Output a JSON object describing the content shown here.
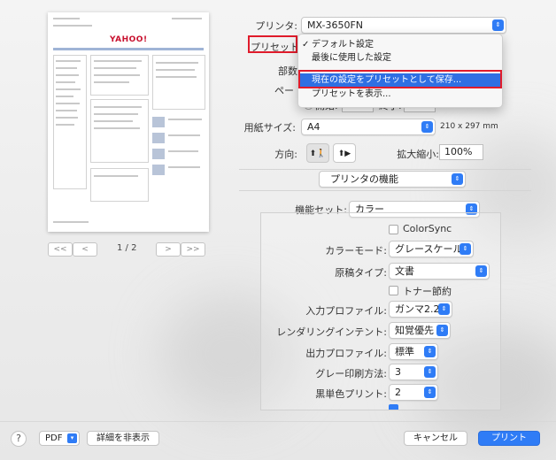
{
  "printer": {
    "label": "プリンタ:",
    "value": "MX-3650FN"
  },
  "preset": {
    "label": "プリセット",
    "menu": {
      "items": [
        {
          "text": "デフォルト設定",
          "checked": true
        },
        {
          "text": "最後に使用した設定"
        },
        {
          "text": "現在の設定をプリセットとして保存...",
          "highlighted": true
        },
        {
          "text": "プリセットを表示..."
        }
      ]
    }
  },
  "partial_labels": {
    "copies": "部数",
    "pages": "ペー"
  },
  "range": {
    "from_label": "開始:",
    "from_value": "1",
    "to_label": "終了:",
    "to_value": "1"
  },
  "paper": {
    "label": "用紙サイズ:",
    "value": "A4",
    "dims": "210 x 297 mm"
  },
  "orientation": {
    "label": "方向:",
    "portrait_glyph": "⬆🚶",
    "landscape_glyph": "⬆▶"
  },
  "scale": {
    "label": "拡大縮小:",
    "value": "100%"
  },
  "section": {
    "value": "プリンタの機能"
  },
  "feature_set": {
    "label": "機能セット:",
    "value": "カラー"
  },
  "options": {
    "colorsync": "ColorSync",
    "color_mode": {
      "label": "カラーモード:",
      "value": "グレースケール"
    },
    "doc_type": {
      "label": "原稿タイプ:",
      "value": "文書"
    },
    "toner_save": "トナー節約",
    "input_profile": {
      "label": "入力プロファイル:",
      "value": "ガンマ2.2"
    },
    "rendering_intent": {
      "label": "レンダリングインテント:",
      "value": "知覚優先"
    },
    "output_profile": {
      "label": "出力プロファイル:",
      "value": "標準"
    },
    "gray_method": {
      "label": "グレー印刷方法:",
      "value": "3"
    },
    "black_print": {
      "label": "黒単色プリント:",
      "value": "2"
    }
  },
  "preview": {
    "page_indicator": "1 / 2",
    "nav": {
      "first": "<<",
      "prev": "<",
      "next": ">",
      "last": ">>"
    },
    "logo": "YAHOO!"
  },
  "bottom": {
    "help": "?",
    "pdf": "PDF",
    "hide_details": "詳細を非表示",
    "cancel": "キャンセル",
    "print": "プリント"
  },
  "colors": {
    "accent": "#2f7cf6",
    "highlight": "#2f6fe3",
    "annotation_red": "#e01b2b"
  }
}
